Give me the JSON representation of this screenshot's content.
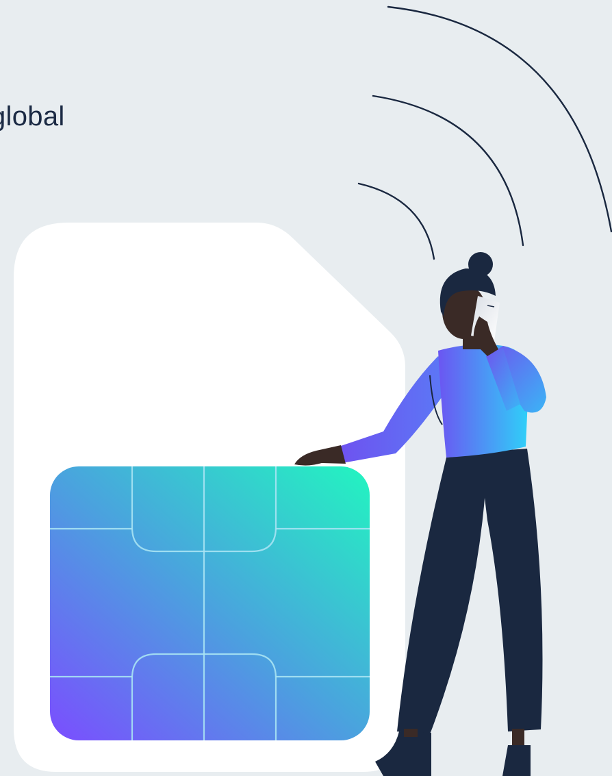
{
  "hero": {
    "text_fragment": "global"
  },
  "illustration": {
    "subject": "person-on-phone-beside-sim-card",
    "icons": [
      "signal-waves-icon",
      "sim-card-icon",
      "sim-chip-icon",
      "phone-icon"
    ],
    "colors": {
      "background": "#e8edf0",
      "sim_card": "#ffffff",
      "chip_gradient_start": "#7b4dff",
      "chip_gradient_mid": "#4aa3de",
      "chip_gradient_end": "#22f5c0",
      "chip_lines": "#a9e3f3",
      "sweater_gradient_start": "#6b56f2",
      "sweater_gradient_end": "#2fd0f8",
      "pants": "#1a2840",
      "hair": "#1a2840",
      "skin": "#3a2a26",
      "signal_waves": "#1a2840"
    }
  }
}
